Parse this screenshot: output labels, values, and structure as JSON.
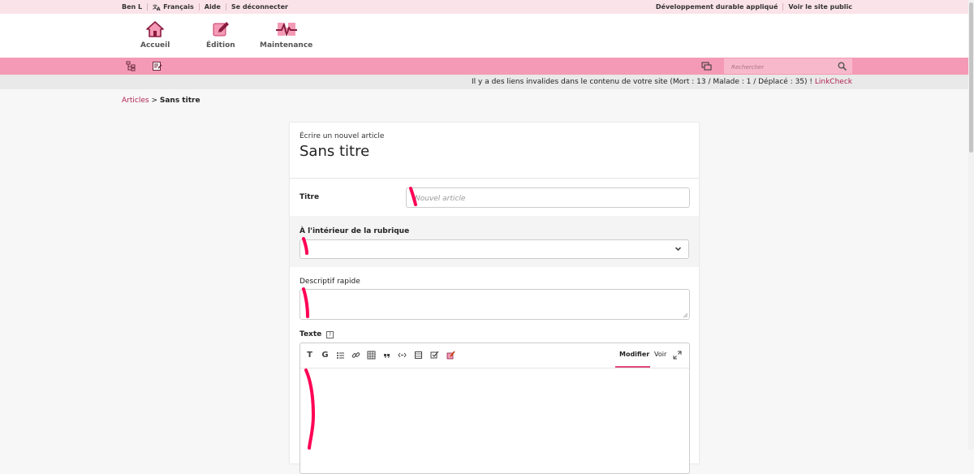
{
  "topbar": {
    "user": "Ben L",
    "language": "Français",
    "help": "Aide",
    "logout": "Se déconnecter",
    "site_name": "Développement durable appliqué",
    "view_site": "Voir le site public"
  },
  "nav": [
    {
      "label": "Accueil",
      "icon": "home-icon"
    },
    {
      "label": "Édition",
      "icon": "edit-icon"
    },
    {
      "label": "Maintenance",
      "icon": "maintenance-icon"
    }
  ],
  "search": {
    "placeholder": "Rechercher"
  },
  "alert": {
    "message": "Il y a des liens invalides dans le contenu de votre site (Mort : 13 / Malade : 1 / Déplacé : 35) !",
    "link": "LinkCheck"
  },
  "breadcrumb": {
    "parent": "Articles",
    "separator": ">",
    "current": "Sans titre"
  },
  "form": {
    "subtitle": "Écrire un nouvel article",
    "title": "Sans titre",
    "titre_label": "Titre",
    "titre_placeholder": "Nouvel article",
    "rubrique_label": "À l'intérieur de la rubrique",
    "descriptif_label": "Descriptif rapide",
    "texte_label": "Texte",
    "help_mark": "?"
  },
  "editor": {
    "tools": [
      "T",
      "G",
      "list-icon",
      "link-icon",
      "table-icon",
      "quote-icon",
      "code-icon",
      "frame-icon",
      "checkbox-icon",
      "special-icon"
    ],
    "tab_modify": "Modifier",
    "tab_view": "Voir"
  },
  "colors": {
    "accent": "#f49ab6",
    "topbar": "#fbe3ea",
    "link": "#b0224f",
    "scribble": "#ff0055"
  }
}
